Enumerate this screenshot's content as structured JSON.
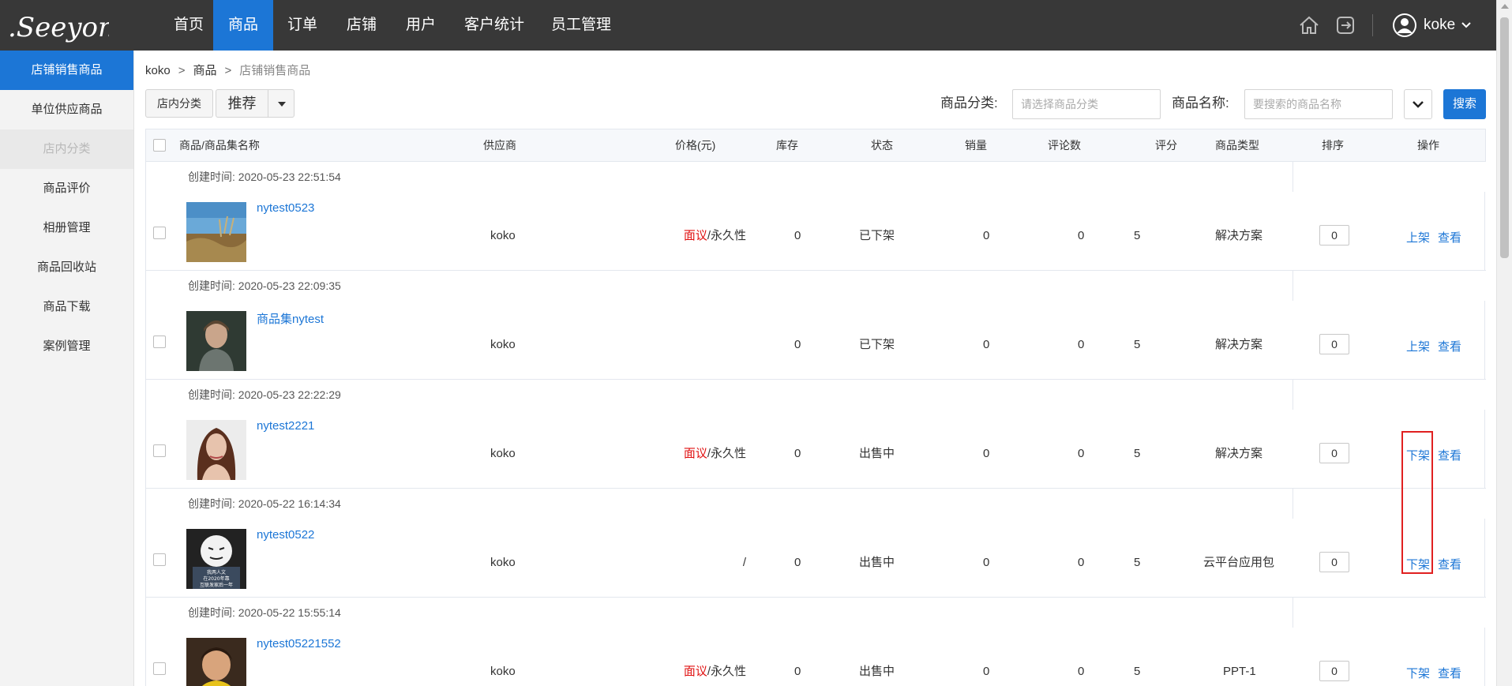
{
  "brand": {
    "logo_text": ".Seeyon",
    "accent": "#1c76d6",
    "nav_bg": "#383838"
  },
  "nav": {
    "items": [
      {
        "label": "首页"
      },
      {
        "label": "商品",
        "active": true
      },
      {
        "label": "订单"
      },
      {
        "label": "店铺"
      },
      {
        "label": "用户"
      },
      {
        "label": "客户统计"
      },
      {
        "label": "员工管理"
      }
    ],
    "icons": [
      "home-icon",
      "logout-icon"
    ],
    "user": {
      "name": "koke"
    }
  },
  "sidebar": {
    "items": [
      {
        "label": "店铺销售商品",
        "state": "active"
      },
      {
        "label": "单位供应商品"
      },
      {
        "label": "店内分类",
        "state": "sub"
      },
      {
        "label": "商品评价"
      },
      {
        "label": "相册管理"
      },
      {
        "label": "商品回收站"
      },
      {
        "label": "商品下载"
      },
      {
        "label": "案例管理"
      }
    ]
  },
  "breadcrumb": {
    "items": [
      "koko",
      "商品"
    ],
    "current": "店铺销售商品"
  },
  "toolbar": {
    "category_button": "店内分类",
    "recommend_button": "推荐",
    "category_label": "商品分类:",
    "category_placeholder": "请选择商品分类",
    "name_label": "商品名称:",
    "name_placeholder": "要搜索的商品名称",
    "search_button": "搜索"
  },
  "table": {
    "headers": {
      "name": "商品/商品集名称",
      "supplier": "供应商",
      "price": "价格(元)",
      "stock": "库存",
      "status": "状态",
      "sales": "销量",
      "reviews": "评论数",
      "score": "评分",
      "type": "商品类型",
      "sort": "排序",
      "actions": "操作"
    },
    "rows": [
      {
        "created": "创建时间: 2020-05-23 22:51:54",
        "name": "nytest0523",
        "supplier": "koko",
        "price_red": "面议",
        "price_rest": "/永久性",
        "stock": "0",
        "status": "已下架",
        "sales": "0",
        "reviews": "0",
        "score": "5",
        "type": "解决方案",
        "sort": "0",
        "action1": "上架",
        "action2": "查看",
        "thumb": "seaside"
      },
      {
        "created": "创建时间: 2020-05-23 22:09:35",
        "name": "商品集nytest",
        "supplier": "koko",
        "price_red": "",
        "price_rest": "",
        "stock": "0",
        "status": "已下架",
        "sales": "0",
        "reviews": "0",
        "score": "5",
        "type": "解决方案",
        "sort": "0",
        "action1": "上架",
        "action2": "查看",
        "thumb": "child"
      },
      {
        "created": "创建时间: 2020-05-23 22:22:29",
        "name": "nytest2221",
        "supplier": "koko",
        "price_red": "面议",
        "price_rest": "/永久性",
        "stock": "0",
        "status": "出售中",
        "sales": "0",
        "reviews": "0",
        "score": "5",
        "type": "解决方案",
        "sort": "0",
        "action1": "下架",
        "action2": "查看",
        "thumb": "woman"
      },
      {
        "created": "创建时间: 2020-05-22 16:14:34",
        "name": "nytest0522",
        "supplier": "koko",
        "price_red": "",
        "price_rest": "/",
        "stock": "0",
        "status": "出售中",
        "sales": "0",
        "reviews": "0",
        "score": "5",
        "type": "云平台应用包",
        "sort": "0",
        "action1": "下架",
        "action2": "查看",
        "thumb": "meme"
      },
      {
        "created": "创建时间: 2020-05-22 15:55:14",
        "name": "nytest05221552",
        "supplier": "koko",
        "price_red": "面议",
        "price_rest": "/永久性",
        "stock": "0",
        "status": "出售中",
        "sales": "0",
        "reviews": "0",
        "score": "5",
        "type": "PPT-1",
        "sort": "0",
        "action1": "下架",
        "action2": "查看",
        "thumb": "baby"
      }
    ],
    "meme_caption": [
      "我两人文",
      "在2020年靠",
      "互联发家后一年"
    ]
  }
}
